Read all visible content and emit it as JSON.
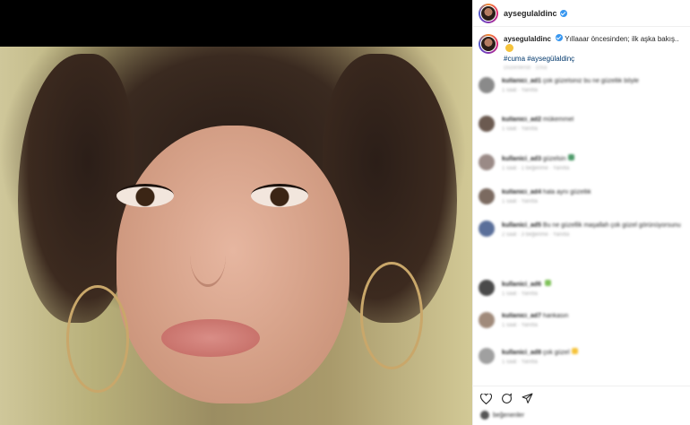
{
  "post": {
    "username": "aysegulaldinc",
    "verified": true,
    "caption_text": "Yıllaaar öncesinden; ilk aşka bakış..",
    "hashtags": "#cuma #aysegülaldinç",
    "caption_meta": "Düzenlendi · 10sa"
  },
  "comments": [
    {
      "user": "kullanici_ad1",
      "text": "çok güzelsiniz bu ne güzellik böyle",
      "meta": "1 saat · Yanıtla",
      "avatar_color": "#8a8a8a"
    },
    {
      "user": "kullanici_ad2",
      "text": "mükemmel",
      "meta": "1 saat · Yanıtla",
      "avatar_color": "#6b5a50"
    },
    {
      "user": "kullanici_ad3",
      "text": "güzelsin",
      "meta": "1 saat · 1 beğenme · Yanıtla",
      "avatar_color": "#9a8a86",
      "emoji_color": "#4e9a6a"
    },
    {
      "user": "kullanici_ad4",
      "text": "hala aynı güzellik",
      "meta": "1 saat · Yanıtla",
      "avatar_color": "#7b6a60"
    },
    {
      "user": "kullanici_ad5",
      "text": "Bu ne güzellik maşallah çok güzel görünüyorsunuz",
      "meta": "2 saat · 3 beğenme · Yanıtla",
      "avatar_color": "#5a6f9a",
      "emoji_color": "#e0554d"
    },
    {
      "user": "kullanici_ad6",
      "text": "",
      "meta": "1 saat · Yanıtla",
      "avatar_color": "#4a4a4a",
      "emoji_color": "#7fc25a"
    },
    {
      "user": "kullanici_ad7",
      "text": "harikasın",
      "meta": "1 saat · Yanıtla",
      "avatar_color": "#a08a7a"
    },
    {
      "user": "kullanici_ad8",
      "text": "çok güzel",
      "meta": "1 saat · Yanıtla",
      "avatar_color": "#a0a0a0",
      "emoji_color": "#f5c33b"
    }
  ],
  "actions": {
    "like_icon": "heart-icon",
    "comment_icon": "comment-icon",
    "share_icon": "share-icon",
    "likes_text": "beğenenler"
  },
  "colors": {
    "link": "#00376b",
    "verified": "#3897f0",
    "meta_gray": "#a8a8a8"
  }
}
